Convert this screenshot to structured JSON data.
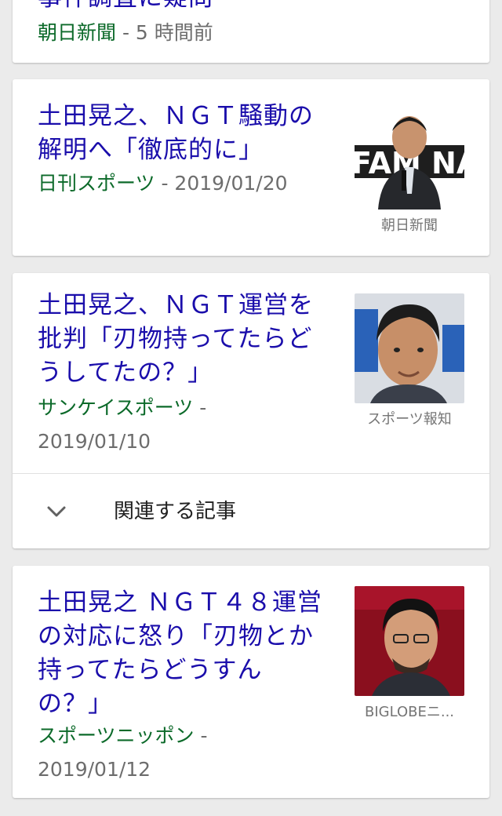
{
  "card0": {
    "title_fragment": "事件調査に疑問",
    "source": "朝日新聞",
    "time": " - 5 時間前"
  },
  "card1": {
    "title_line1": "土田晃之、ＮＧＴ騒動の",
    "title_line2": "解明へ「徹底的に」",
    "source": "日刊スポーツ",
    "date": " - 2019/01/20",
    "thumb_caption": "朝日新聞",
    "thumb_text": "FAM NADA"
  },
  "card2": {
    "title_line1": "土田晃之、ＮＧＴ運営を",
    "title_line2": "批判「刃物持ってたらど",
    "title_line3": "うしてたの？」",
    "source": "サンケイスポーツ",
    "dash": " -",
    "date": "2019/01/10",
    "thumb_caption": "スポーツ報知",
    "related_label": "関連する記事",
    "related_icon": "chevron-down-icon"
  },
  "card3": {
    "title_line1": "土田晃之 ＮＧＴ４８運営",
    "title_line2": "の対応に怒り「刃物とか",
    "title_line3": "持ってたらどうすん",
    "title_line4": "の？」",
    "source": "スポーツニッポン",
    "dash": " -",
    "date": "2019/01/12",
    "thumb_caption": "BIGLOBEニ..."
  },
  "colors": {
    "title": "#1a0dab",
    "source": "#0c6a2a",
    "meta": "#6d6d6d",
    "background": "#ebebeb"
  }
}
